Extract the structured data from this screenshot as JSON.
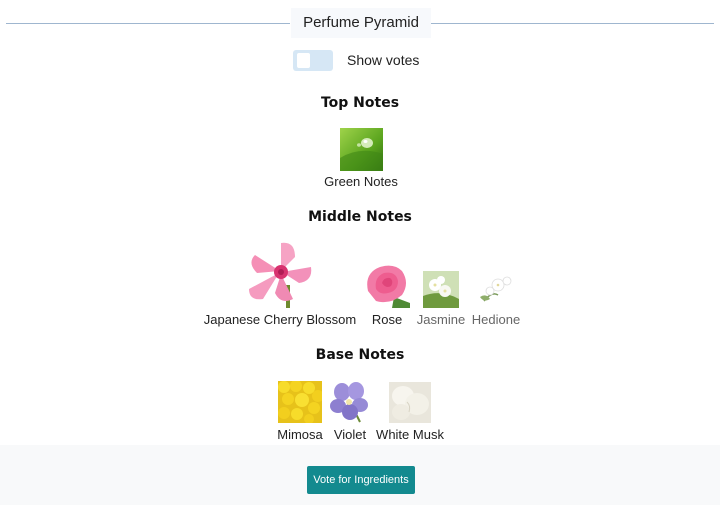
{
  "header": {
    "title": "Perfume Pyramid"
  },
  "toggle": {
    "label": "Show votes",
    "checked": false
  },
  "sections": {
    "top": {
      "title": "Top Notes",
      "notes": [
        {
          "label": "Green Notes",
          "icon": "water-drop-on-leaf-image"
        }
      ]
    },
    "middle": {
      "title": "Middle Notes",
      "notes": [
        {
          "label": "Japanese Cherry Blossom",
          "icon": "cherry-blossom-image"
        },
        {
          "label": "Rose",
          "icon": "rose-image"
        },
        {
          "label": "Jasmine",
          "icon": "jasmine-image"
        },
        {
          "label": "Hedione",
          "icon": "hedione-flower-image"
        }
      ]
    },
    "base": {
      "title": "Base Notes",
      "notes": [
        {
          "label": "Mimosa",
          "icon": "mimosa-image"
        },
        {
          "label": "Violet",
          "icon": "violet-image"
        },
        {
          "label": "White Musk",
          "icon": "white-musk-image"
        }
      ]
    }
  },
  "footer": {
    "vote_button_label": "Vote for Ingredients"
  },
  "colors": {
    "accent": "#138a8f",
    "toggle_bg": "#d6e7f5",
    "header_line": "#9fb6cf"
  }
}
